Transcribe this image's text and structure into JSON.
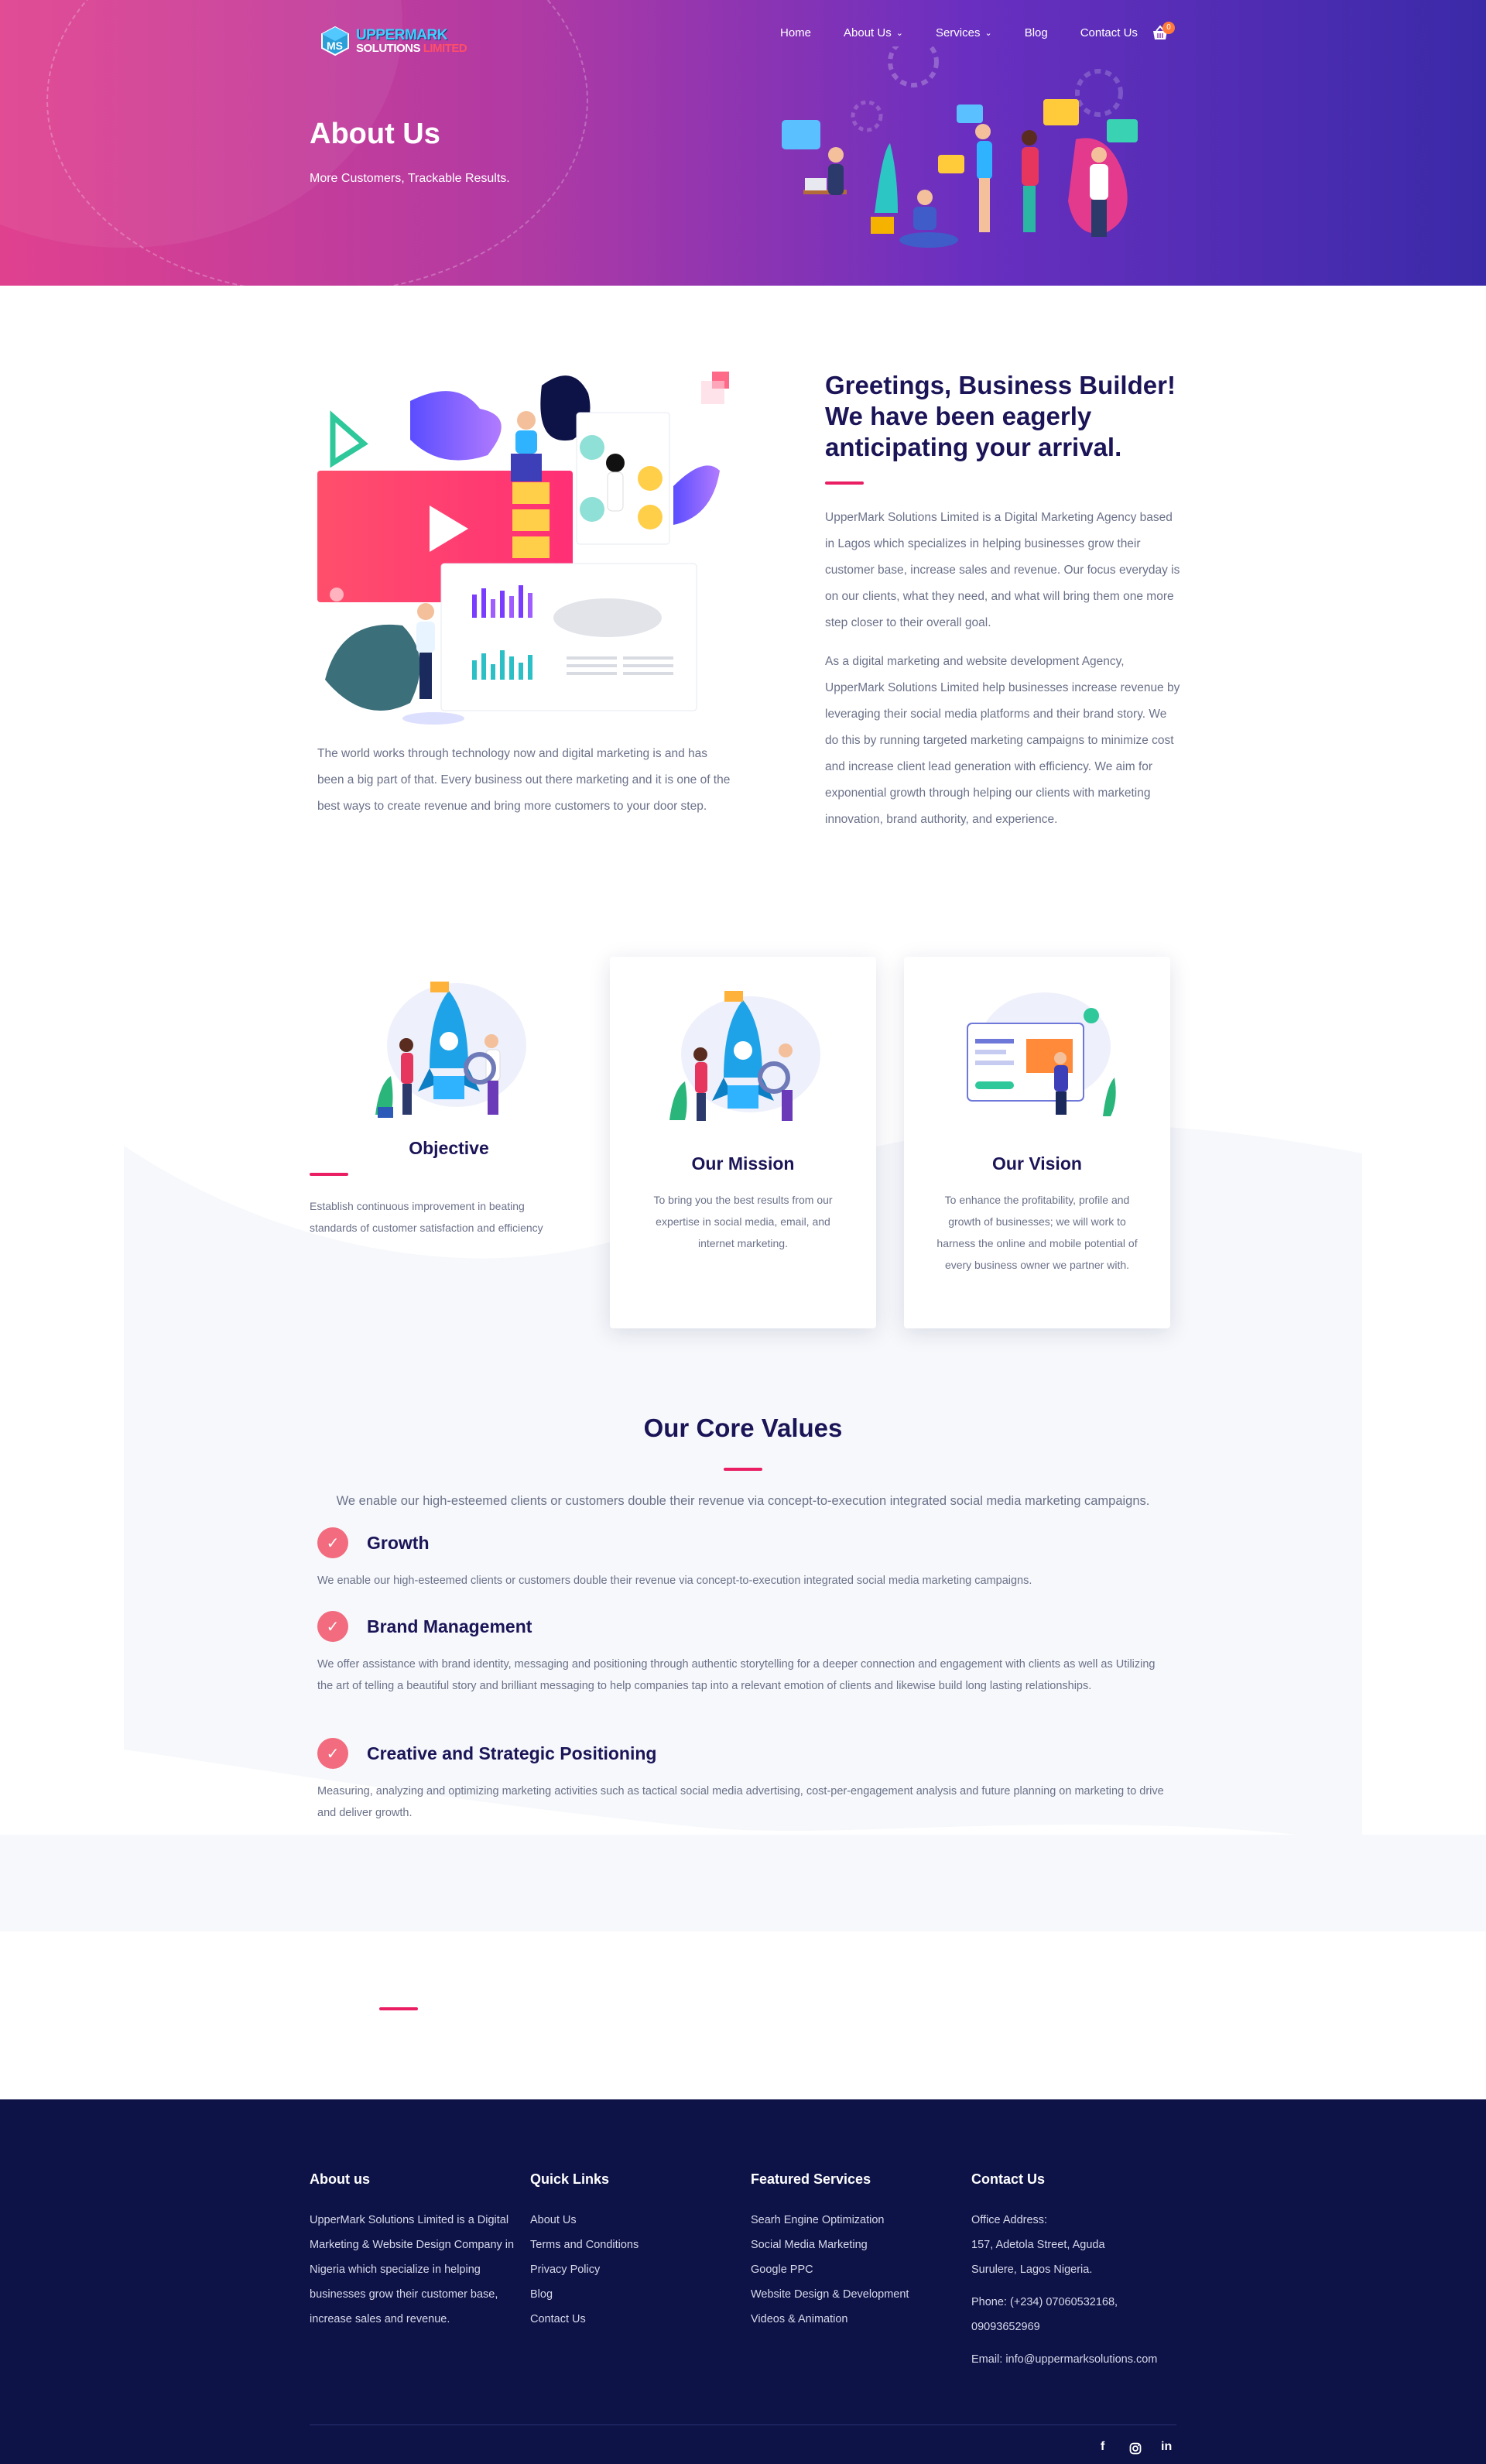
{
  "brand": {
    "line1": "UPPERMARK",
    "line2a": "SOLUTIONS",
    "line2b": "LIMITED"
  },
  "nav": {
    "items": [
      {
        "label": "Home",
        "dropdown": false
      },
      {
        "label": "About Us",
        "dropdown": true
      },
      {
        "label": "Services",
        "dropdown": true
      },
      {
        "label": "Blog",
        "dropdown": false
      },
      {
        "label": "Contact Us",
        "dropdown": false
      }
    ],
    "cart_count": "0"
  },
  "hero": {
    "title": "About Us",
    "subtitle": "More Customers, Trackable Results."
  },
  "intro": {
    "left_text": "The world works through technology now and digital marketing is and has been a big part of that. Every business out there marketing and it is one of the best ways to create revenue and bring more customers to your door step.",
    "heading": "Greetings, Business Builder! We have been eagerly anticipating your arrival.",
    "para1": "UpperMark Solutions Limited is a Digital Marketing Agency based in Lagos which specializes in helping businesses grow their customer base, increase sales and revenue. Our focus everyday is on our clients, what they need, and what will bring them one more step closer to their overall goal.",
    "para2": "As a digital marketing and website development Agency, UpperMark Solutions Limited help businesses increase revenue by leveraging their social media platforms and their brand story. We do this by running targeted marketing campaigns to minimize cost and increase client lead generation with efficiency. We aim for exponential growth through helping our clients with marketing innovation, brand authority, and experience."
  },
  "cards": [
    {
      "title": "Objective",
      "text": "Establish continuous improvement in beating standards of customer satisfaction and efficiency"
    },
    {
      "title": "Our Mission",
      "text": "To bring you the best results from our expertise in social media, email, and internet marketing."
    },
    {
      "title": "Our Vision",
      "text": "To enhance the profitability, profile and growth of businesses; we will work to harness the online and mobile potential of every business owner we partner with."
    }
  ],
  "core_values": {
    "title": "Our Core Values",
    "intro": "We enable our high-esteemed clients or customers double their revenue via concept-to-execution integrated social media marketing campaigns.",
    "items": [
      {
        "title": "Growth",
        "text": "We enable our high-esteemed clients or customers double their revenue via concept-to-execution integrated social media marketing campaigns."
      },
      {
        "title": "Brand Management",
        "text": "We offer assistance with brand identity, messaging and positioning through authentic storytelling for a deeper connection and engagement with clients as well as Utilizing the art of telling a beautiful story and brilliant messaging to help companies tap into a relevant emotion of clients and likewise build long lasting relationships."
      },
      {
        "title": "Creative and Strategic Positioning",
        "text": "Measuring, analyzing and optimizing marketing activities such as tactical social media advertising, cost-per-engagement analysis and future planning on marketing to drive and deliver growth."
      }
    ]
  },
  "footer": {
    "about": {
      "title": "About us",
      "text": "UpperMark Solutions Limited is a Digital Marketing & Website Design Company in Nigeria which specialize in helping businesses grow their customer base, increase sales and revenue."
    },
    "quick_links": {
      "title": "Quick Links",
      "items": [
        "About Us",
        "Terms and Conditions",
        "Privacy Policy",
        "Blog",
        "Contact Us"
      ]
    },
    "services": {
      "title": "Featured Services",
      "items": [
        "Searh Engine Optimization",
        "Social Media Marketing",
        "Google PPC",
        "Website Design & Development",
        "Videos & Animation"
      ]
    },
    "contact": {
      "title": "Contact Us",
      "address_label": "Office Address:",
      "address_line1": "157, Adetola Street, Aguda",
      "address_line2": "Surulere, Lagos Nigeria.",
      "phone_line1": "Phone: (+234) 07060532168,",
      "phone_line2": "09093652969",
      "email": "Email: info@uppermarksolutions.com"
    },
    "social": [
      "f",
      "in"
    ]
  },
  "colors": {
    "accent": "#e91e63",
    "navy": "#1b1558",
    "footer_bg": "#0d1247",
    "check": "#f26b7e"
  }
}
